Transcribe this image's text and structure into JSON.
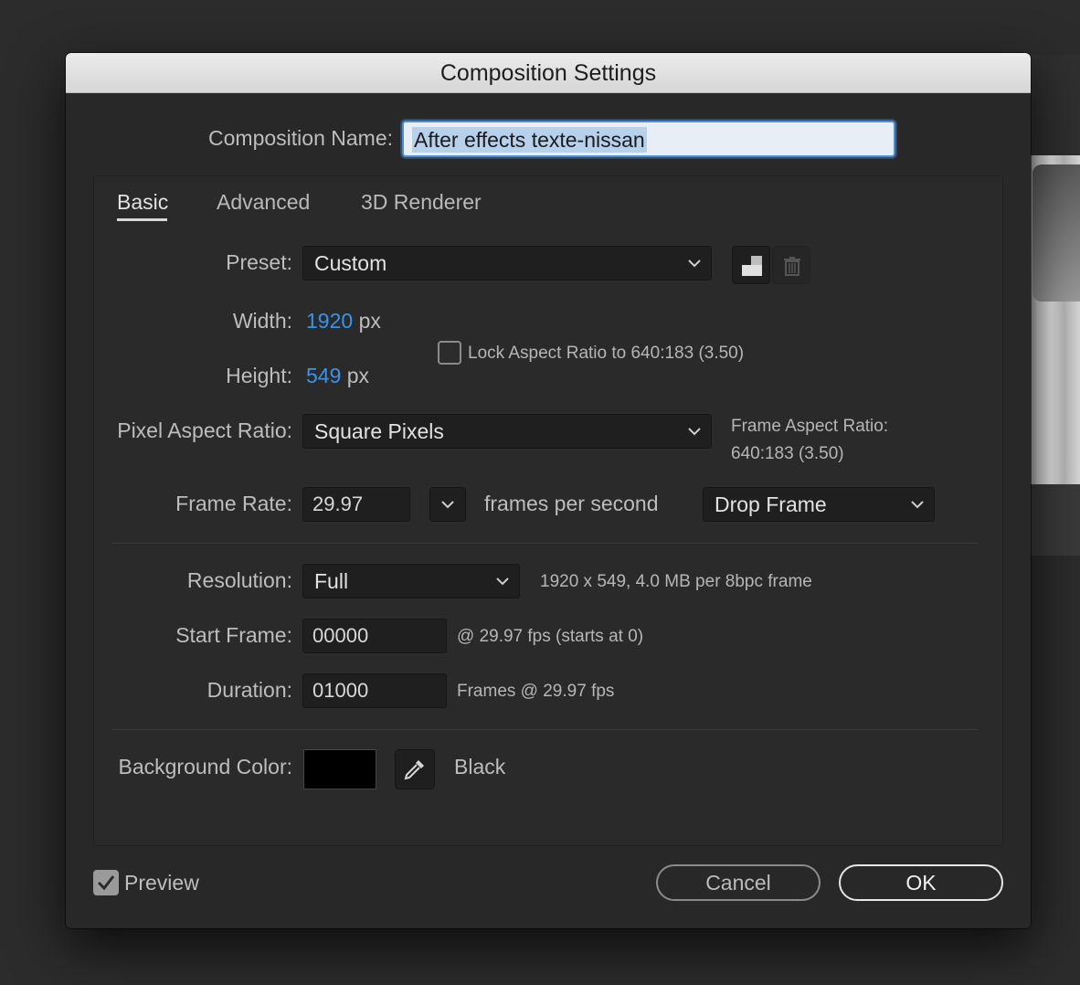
{
  "window": {
    "title": "Composition Settings"
  },
  "comp_name": {
    "label": "Composition Name:",
    "value": "After effects texte-nissan"
  },
  "tabs": [
    {
      "label": "Basic",
      "active": true
    },
    {
      "label": "Advanced",
      "active": false
    },
    {
      "label": "3D Renderer",
      "active": false
    }
  ],
  "preset": {
    "label": "Preset:",
    "value": "Custom",
    "icons": [
      "save-preset-icon",
      "trash-icon"
    ]
  },
  "width": {
    "label": "Width:",
    "value": "1920",
    "unit": "px"
  },
  "height": {
    "label": "Height:",
    "value": "549",
    "unit": "px"
  },
  "lock_aspect": {
    "label": "Lock Aspect Ratio to 640:183 (3.50)",
    "checked": false
  },
  "pixel_aspect": {
    "label": "Pixel Aspect Ratio:",
    "value": "Square Pixels"
  },
  "frame_aspect": {
    "label": "Frame Aspect Ratio:",
    "value": "640:183 (3.50)"
  },
  "frame_rate": {
    "label": "Frame Rate:",
    "value": "29.97",
    "unit_text": "frames per second",
    "mode": "Drop Frame"
  },
  "resolution": {
    "label": "Resolution:",
    "value": "Full",
    "info": "1920 x 549, 4.0 MB per 8bpc frame"
  },
  "start_frame": {
    "label": "Start Frame:",
    "value": "00000",
    "info": "@ 29.97 fps (starts at 0)"
  },
  "duration": {
    "label": "Duration:",
    "value": "01000",
    "info": "Frames @ 29.97 fps"
  },
  "background": {
    "label": "Background Color:",
    "color_name": "Black",
    "color": "#000000"
  },
  "footer": {
    "preview_label": "Preview",
    "preview_checked": true,
    "cancel_label": "Cancel",
    "ok_label": "OK"
  },
  "colors": {
    "accent": "#3a93e8",
    "dialog_bg": "#282828",
    "selection": "#b7d0ec"
  }
}
